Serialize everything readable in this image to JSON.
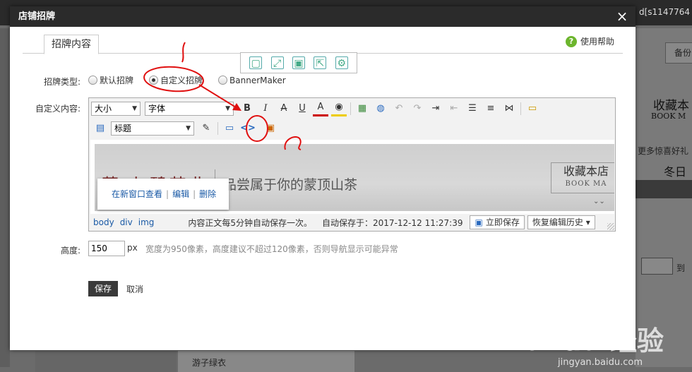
{
  "background": {
    "top_right_text": "d[s1147764",
    "side_text_1": "备份",
    "side_text_2": "收藏本",
    "side_text_3": "BOOK M",
    "side_text_4": "更多惊喜好礼",
    "side_text_5": "冬日",
    "side_text_6": "到",
    "bottom_text": "游子绿衣"
  },
  "dialog": {
    "title": "店铺招牌",
    "close": "×",
    "tab": "招牌内容",
    "help": "使用帮助",
    "help_icon": "?"
  },
  "float_tools": [
    "▢",
    "⤢",
    "▣",
    "⇱",
    "⚙"
  ],
  "form": {
    "type_label": "招牌类型:",
    "radios": [
      "默认招牌",
      "自定义招牌",
      "BannerMaker"
    ],
    "selected_radio": "自定义招牌",
    "content_label": "自定义内容:",
    "height_label": "高度:",
    "height_value": "150",
    "height_unit": "px",
    "height_hint": "宽度为950像素，高度建议不超过120像素，否则导航显示可能异常",
    "save": "保存",
    "cancel": "取消"
  },
  "editor": {
    "size_select": "大小",
    "font_select": "字体",
    "heading_select": "标题",
    "toolbar_row1": [
      "B",
      "I",
      "A",
      "U",
      "A",
      "◉",
      "▦",
      "◍",
      "↶",
      "↷",
      "⇥",
      "⇤",
      "☰",
      "≡",
      "⋈",
      "▭"
    ],
    "toolbar_row2": [
      "▤",
      "✎",
      "▭",
      "<>",
      "▣"
    ],
    "banner": {
      "logo": "茗 七碧茶业",
      "slogan": "品尝属于你的蒙顶山茶",
      "box_title": "收藏本店",
      "box_sub": "BOOK MA",
      "chevrons": "⌄⌄"
    },
    "popup": {
      "open_new": "在新窗口查看",
      "edit": "编辑",
      "delete": "删除",
      "sep": "|"
    },
    "path": [
      "body",
      "div",
      "img"
    ],
    "status": "内容正文每5分钟自动保存一次。",
    "autosave": "自动保存于：2017-12-12 11:27:39",
    "save_now": "立即保存",
    "restore": "恢复编辑历史"
  },
  "watermark": {
    "main": "Bai du 经验",
    "sub": "jingyan.baidu.com"
  }
}
